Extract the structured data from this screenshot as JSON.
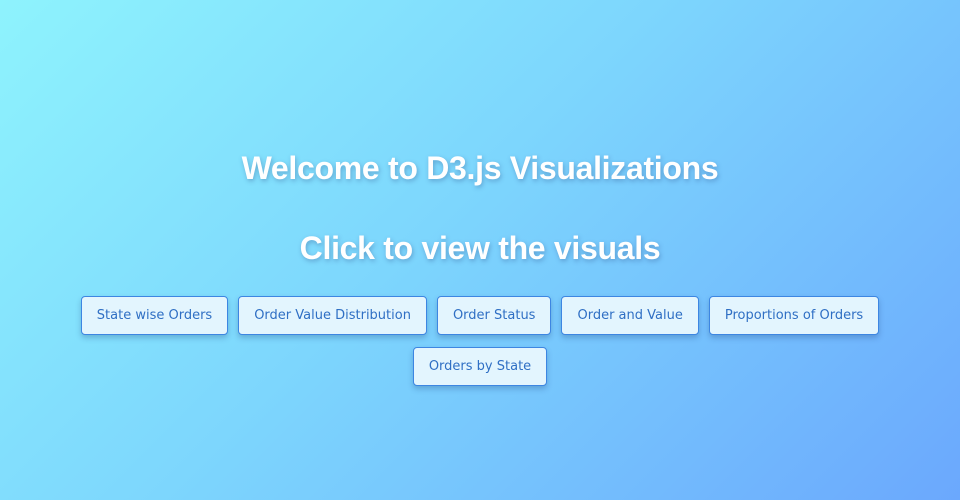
{
  "header": {
    "welcome": "Welcome to D3.js Visualizations",
    "prompt": "Click to view the visuals"
  },
  "buttons": [
    {
      "label": "State wise Orders"
    },
    {
      "label": "Order Value Distribution"
    },
    {
      "label": "Order Status"
    },
    {
      "label": "Order and Value"
    },
    {
      "label": "Proportions of Orders"
    },
    {
      "label": "Orders by State"
    }
  ],
  "colors": {
    "gradient_start": "#8ef3fd",
    "gradient_end": "#6ba8fd",
    "button_bg": "#e3f5fe",
    "button_border": "#3d86e2",
    "button_text": "#2f6fc4",
    "title_text": "#ffffff"
  }
}
